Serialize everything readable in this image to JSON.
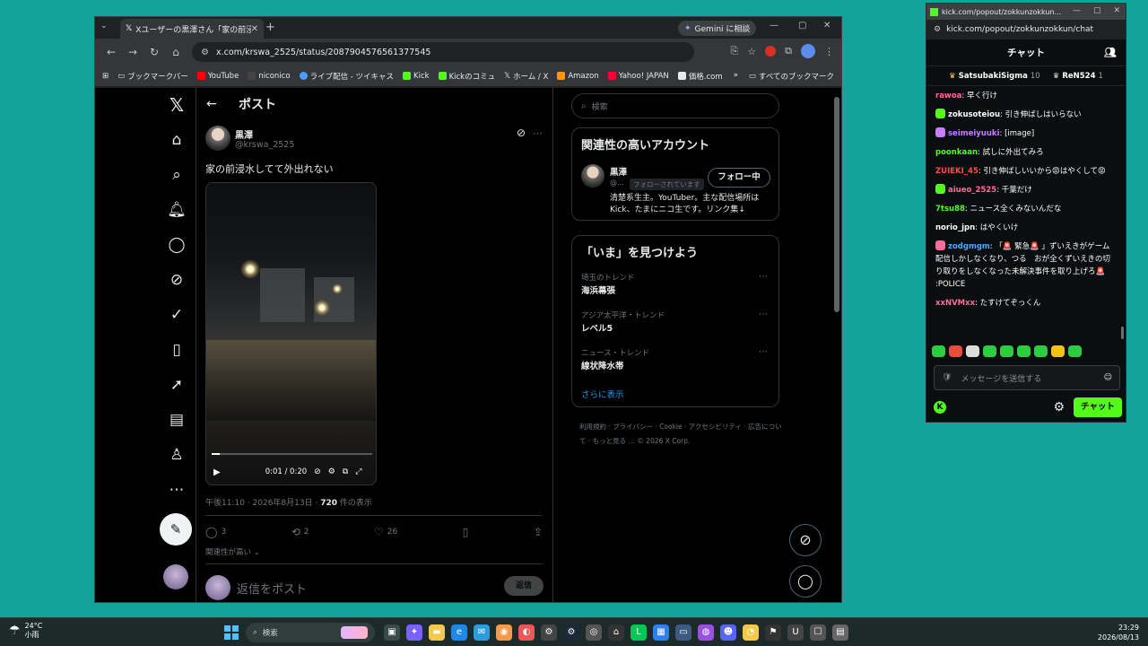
{
  "browser": {
    "tab_title": "Xユーザーの黒澤さん「家の前浸水…",
    "gemini_label": "Gemini に相談",
    "url": "x.com/krswa_2525/status/2087904576561377545",
    "bookmarks": [
      "ブックマークバー",
      "YouTube",
      "niconico",
      "ライブ配信 - ツイキャス",
      "Kick",
      "Kickのコミュ",
      "ホーム / X",
      "Amazon",
      "Yahoo! JAPAN",
      "価格.com"
    ],
    "all_bookmarks": "すべてのブックマーク"
  },
  "x": {
    "header_title": "ポスト",
    "author_name": "黒澤",
    "author_handle": "@krswa_2525",
    "post_text": "家の前浸水してて外出れない",
    "video_time": "0:01 / 0:20",
    "video_progress": 0.05,
    "meta_time": "午後11:10 · 2026年8月13日 · ",
    "meta_views": "720",
    "meta_views_suffix": " 件の表示",
    "actions": {
      "replies": "3",
      "reposts": "2",
      "likes": "26"
    },
    "relevance": "関連性が高い",
    "reply_placeholder": "返信をポスト",
    "reply_button": "返信",
    "search_placeholder": "検索",
    "related_title": "関連性の高いアカウント",
    "related": {
      "name": "黒澤",
      "handle": "@...",
      "badge": "フォローされています",
      "follow_label": "フォロー中",
      "bio": "清楚系生主。YouTuber。主な配信場所はKick、たまにニコ生です。リンク集↓"
    },
    "trends_title": "「いま」を見つけよう",
    "trends": [
      {
        "context": "埼玉のトレンド",
        "name": "海浜幕張"
      },
      {
        "context": "アジア太平洋・トレンド",
        "name": "レベル5"
      },
      {
        "context": "ニュース・トレンド",
        "name": "線状降水帯"
      }
    ],
    "show_more": "さらに表示",
    "footer": "利用規約 · プライバシー · Cookie · アクセシビリティ · 広告について · もっと見る … © 2026 X Corp."
  },
  "kick": {
    "window_title": "kick.com/popout/zokkunzokkun...",
    "url": "kick.com/popout/zokkunzokkun/chat",
    "header": "チャット",
    "leaders": [
      {
        "name": "SatsubakiSigma",
        "count": "10"
      },
      {
        "name": "ReN524",
        "count": "1"
      }
    ],
    "messages": [
      {
        "user": "rawoa",
        "color": "#ff6b9a",
        "text": "早く行け"
      },
      {
        "user": "zokusoteiou",
        "color": "#ffffff",
        "text": "引き伸ばしはいらない"
      },
      {
        "user": "seimeiyuuki",
        "color": "#c77dff",
        "text": "[image]"
      },
      {
        "user": "poonkaan",
        "color": "#53fc18",
        "text": "試しに外出てみろ"
      },
      {
        "user": "ZUIEKI_45",
        "color": "#ff4d4d",
        "text": "引き伸ばしいいから😡はやくして😡"
      },
      {
        "user": "aiueo_2525",
        "color": "#ff6b9a",
        "text": "千葉だけ"
      },
      {
        "user": "7tsu88",
        "color": "#53fc18",
        "text": "ニュース全くみないんだな"
      },
      {
        "user": "norio_jpn",
        "color": "#ffffff",
        "text": "はやくいけ"
      },
      {
        "user": "zodgmgm",
        "color": "#4ea8ff",
        "text": "「🚨 緊急🚨 」ずいえきがゲーム配信しかしなくなり、つる　おが全くずいえきの切り取りをしなくなった未解決事件を取り上げろ🚨 :POLICE"
      },
      {
        "user": "xxNVMxx",
        "color": "#ff6b9a",
        "text": "たすけてぞっくん"
      }
    ],
    "input_placeholder": "メッセージを送信する",
    "send_label": "チャット"
  },
  "taskbar": {
    "temp": "24°C",
    "weather": "小雨",
    "search": "検索",
    "time": "23:29",
    "date": "2026/08/13"
  }
}
